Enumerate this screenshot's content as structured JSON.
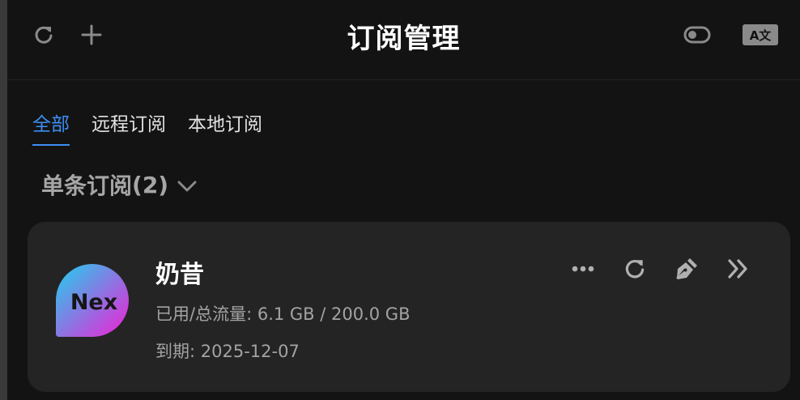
{
  "header": {
    "title": "订阅管理",
    "left_icons": [
      "refresh-icon",
      "plus-icon"
    ],
    "right_icons": [
      "toggle-icon",
      "translate-icon"
    ],
    "translate_badge": "A文"
  },
  "tabs": [
    {
      "label": "全部",
      "active": true
    },
    {
      "label": "远程订阅",
      "active": false
    },
    {
      "label": "本地订阅",
      "active": false
    }
  ],
  "section": {
    "title": "单条订阅",
    "count": "(2)"
  },
  "subscription": {
    "name": "奶昔",
    "logo_text": "Nex",
    "traffic_label": "已用/总流量: ",
    "traffic_value": "6.1 GB / 200.0 GB",
    "expire_label": "到期: ",
    "expire_value": "2025-12-07",
    "actions": [
      "more-icon",
      "refresh-icon",
      "edit-pen-icon",
      "double-chevron-right-icon"
    ]
  },
  "colors": {
    "accent": "#3d8ef5",
    "background": "#131313",
    "card": "#242424",
    "logo_gradient_start": "#1fd1ee",
    "logo_gradient_end": "#f21fd6"
  }
}
